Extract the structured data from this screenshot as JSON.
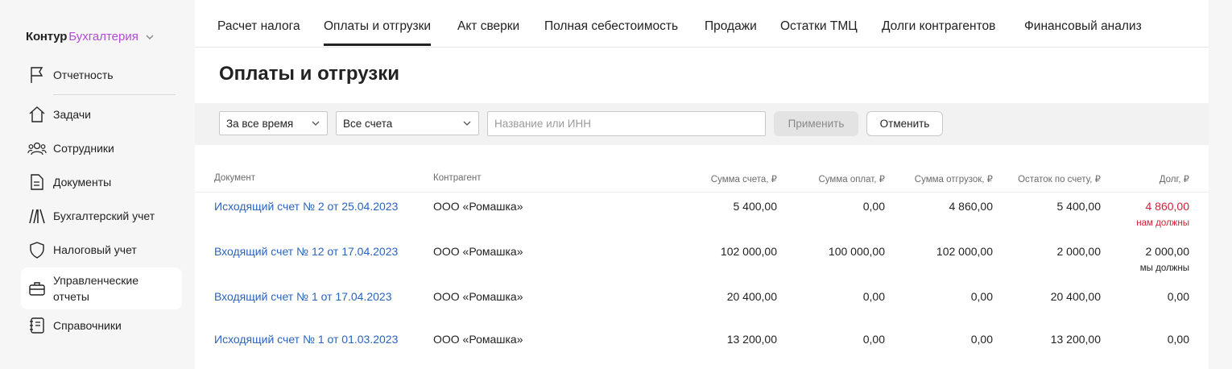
{
  "logo": {
    "brand": "Контур",
    "product": "Бухгалтерия"
  },
  "sidebar": {
    "items": [
      {
        "label": "Отчетность",
        "icon": "flag-icon"
      },
      {
        "label": "Задачи",
        "icon": "home-icon"
      },
      {
        "label": "Сотрудники",
        "icon": "people-icon"
      },
      {
        "label": "Документы",
        "icon": "document-icon"
      },
      {
        "label": "Бухгалтерский учет",
        "icon": "books-icon"
      },
      {
        "label": "Налоговый учет",
        "icon": "shield-icon"
      },
      {
        "label": "Управленческие отчеты",
        "icon": "briefcase-icon"
      },
      {
        "label": "Справочники",
        "icon": "notebook-icon"
      }
    ]
  },
  "tabs": [
    "Расчет налога",
    "Оплаты и отгрузки",
    "Акт сверки",
    "Полная себестоимость",
    "Продажи",
    "Остатки ТМЦ",
    "Долги контрагентов",
    "Финансовый анализ"
  ],
  "active_tab": "Оплаты и отгрузки",
  "page": {
    "title": "Оплаты и отгрузки"
  },
  "filters": {
    "period": "За все время",
    "accounts": "Все счета",
    "search_placeholder": "Название или ИНН",
    "apply": "Применить",
    "cancel": "Отменить"
  },
  "table": {
    "headers": {
      "document": "Документ",
      "counterparty": "Контрагент",
      "invoice_sum": "Сумма счета, ₽",
      "payments_sum": "Сумма оплат, ₽",
      "shipments_sum": "Сумма отгрузок, ₽",
      "balance": "Остаток по счету, ₽",
      "debt": "Долг, ₽"
    },
    "rows": [
      {
        "document": "Исходящий счет № 2 от 25.04.2023",
        "counterparty": "ООО «Ромашка»",
        "invoice_sum": "5 400,00",
        "payments_sum": "0,00",
        "shipments_sum": "4 860,00",
        "balance": "5 400,00",
        "debt": "4 860,00",
        "debt_note": "нам должны"
      },
      {
        "document": "Входящий счет № 12 от 17.04.2023",
        "counterparty": "ООО «Ромашка»",
        "invoice_sum": "102 000,00",
        "payments_sum": "100 000,00",
        "shipments_sum": "102 000,00",
        "balance": "2 000,00",
        "debt": "2 000,00",
        "debt_note": "мы должны"
      },
      {
        "document": "Входящий счет № 1 от 17.04.2023",
        "counterparty": "ООО «Ромашка»",
        "invoice_sum": "20 400,00",
        "payments_sum": "0,00",
        "shipments_sum": "0,00",
        "balance": "20 400,00",
        "debt": "0,00"
      },
      {
        "document": "Исходящий счет № 1 от 01.03.2023",
        "counterparty": "ООО «Ромашка»",
        "invoice_sum": "13 200,00",
        "payments_sum": "0,00",
        "shipments_sum": "0,00",
        "balance": "13 200,00",
        "debt": "0,00"
      }
    ]
  },
  "colors": {
    "accent": "#b34ad8",
    "link": "#2b64bd",
    "debt_red": "#d3203a"
  }
}
